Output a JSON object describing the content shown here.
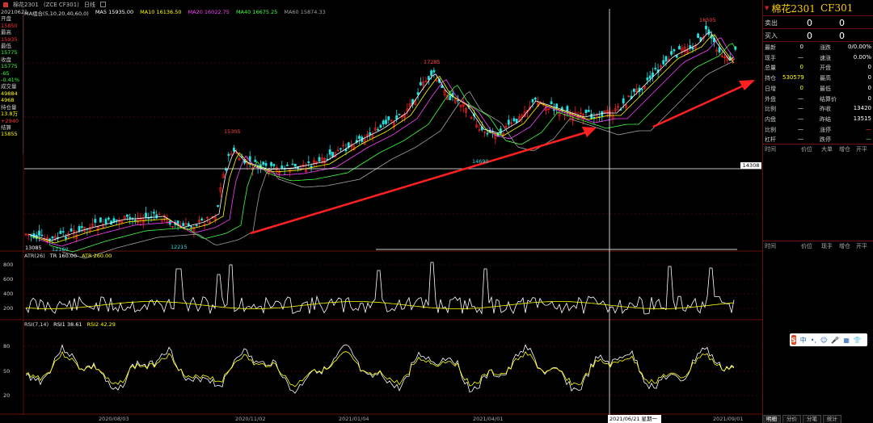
{
  "toolbar": {
    "symbol": "棉花2301",
    "symbol_code": "(ZCE CF301)",
    "period": "日线"
  },
  "ma_legend": {
    "title": "MA组合(5,10,20,40,60,0)",
    "items": [
      {
        "label": "MA5 15935.00",
        "color": "#ffffff"
      },
      {
        "label": "MA10 16136.50",
        "color": "#ffff00"
      },
      {
        "label": "MA20 16022.75",
        "color": "#ff40ff"
      },
      {
        "label": "MA40 16675.25",
        "color": "#40ff40"
      },
      {
        "label": "MA60 15874.33",
        "color": "#a0a0a0"
      }
    ]
  },
  "left_info": [
    {
      "text": "20210621",
      "color": "#cccccc"
    },
    {
      "text": "开盘",
      "color": "#cccccc"
    },
    {
      "text": "15850",
      "color": "#ff3030"
    },
    {
      "text": "最高",
      "color": "#cccccc"
    },
    {
      "text": "15935",
      "color": "#ff3030"
    },
    {
      "text": "最低",
      "color": "#cccccc"
    },
    {
      "text": "15775",
      "color": "#30ff30"
    },
    {
      "text": "收盘",
      "color": "#cccccc"
    },
    {
      "text": "15775",
      "color": "#30ff30"
    },
    {
      "text": "-65",
      "color": "#30ff30"
    },
    {
      "text": "-0.41%",
      "color": "#30ff30"
    },
    {
      "text": "成交量",
      "color": "#cccccc"
    },
    {
      "text": "49884",
      "color": "#ffff00"
    },
    {
      "text": "4968",
      "color": "#ffff00"
    },
    {
      "text": "持仓量",
      "color": "#cccccc"
    },
    {
      "text": "13.8万",
      "color": "#ffff00"
    },
    {
      "text": "+2940",
      "color": "#ff3030"
    },
    {
      "text": "结算",
      "color": "#cccccc"
    },
    {
      "text": "15855",
      "color": "#ffff00"
    }
  ],
  "annotations": {
    "high": "18505",
    "peak2": "17285",
    "peak1": "15305",
    "low1": "12215",
    "low0": "12160",
    "low_mid": "14690",
    "start": "13085",
    "cursor_price": "14308"
  },
  "atr_legend": {
    "title": "ATR(26)",
    "items": [
      {
        "label": "TR 160.00",
        "color": "#ffffff"
      },
      {
        "label": "ATR 260.00",
        "color": "#ffff00"
      }
    ],
    "ticks": [
      "800",
      "600",
      "400",
      "200"
    ]
  },
  "rsi_legend": {
    "title": "RSI(7,14)",
    "items": [
      {
        "label": "RSI1 38.61",
        "color": "#ffffff"
      },
      {
        "label": "RSI2 42.29",
        "color": "#ffff00"
      }
    ],
    "ticks": [
      "80",
      "50",
      "20"
    ]
  },
  "date_axis": [
    "2020/08/03",
    "2020/11/02",
    "2021/01/04",
    "2021/04/01",
    "2021/09/01"
  ],
  "date_cursor": "2021/06/21 星期一",
  "quote_panel": {
    "title": "棉花2301",
    "code": "CF301",
    "sell_label": "卖出",
    "sell_price": "0",
    "sell_vol": "0",
    "buy_label": "买入",
    "buy_price": "0",
    "buy_vol": "0",
    "rows": [
      {
        "l1": "最新",
        "v1": "0",
        "c1": "#ffffff",
        "l2": "涨跌",
        "v2": "0/0.00%",
        "c2": "#ffffff"
      },
      {
        "l1": "现手",
        "v1": "—",
        "c1": "#ffffff",
        "l2": "速涨",
        "v2": "0.00%",
        "c2": "#ffffff"
      },
      {
        "l1": "总量",
        "v1": "0",
        "c1": "#ffff00",
        "l2": "开盘",
        "v2": "0",
        "c2": "#ffffff"
      },
      {
        "l1": "持仓",
        "v1": "530579",
        "c1": "#ffff00",
        "l2": "最高",
        "v2": "0",
        "c2": "#ffffff"
      },
      {
        "l1": "日增",
        "v1": "0",
        "c1": "#ffff00",
        "l2": "最低",
        "v2": "0",
        "c2": "#ffffff"
      },
      {
        "l1": "外盘",
        "v1": "—",
        "c1": "#ffffff",
        "l2": "结算价",
        "v2": "0",
        "c2": "#ffffff"
      },
      {
        "l1": "比例",
        "v1": "—",
        "c1": "#ffffff",
        "l2": "昨收",
        "v2": "13420",
        "c2": "#ffffff"
      },
      {
        "l1": "内盘",
        "v1": "—",
        "c1": "#ffffff",
        "l2": "昨结",
        "v2": "13515",
        "c2": "#ffffff"
      },
      {
        "l1": "比例",
        "v1": "—",
        "c1": "#ffffff",
        "l2": "涨停",
        "v2": "—",
        "c2": "#ff3030"
      },
      {
        "l1": "杠杆",
        "v1": "—",
        "c1": "#ffffff",
        "l2": "跌停",
        "v2": "—",
        "c2": "#30ff30"
      }
    ],
    "trade_header": [
      "时间",
      "价位",
      "大单",
      "增仓",
      "开平"
    ],
    "tick_header": [
      "时间",
      "价位",
      "现手",
      "增仓",
      "开平"
    ]
  },
  "tabs": [
    "明细",
    "分价",
    "分笔",
    "统计"
  ],
  "ime": {
    "logo": "S",
    "items": [
      "中",
      "•,",
      "☺",
      "🎤",
      "▦",
      "👕",
      "⋮⋮"
    ]
  },
  "colors": {
    "up": "#ff2020",
    "down": "#20e0e0",
    "grid": "#6a1010",
    "arrow": "#ff2020"
  }
}
